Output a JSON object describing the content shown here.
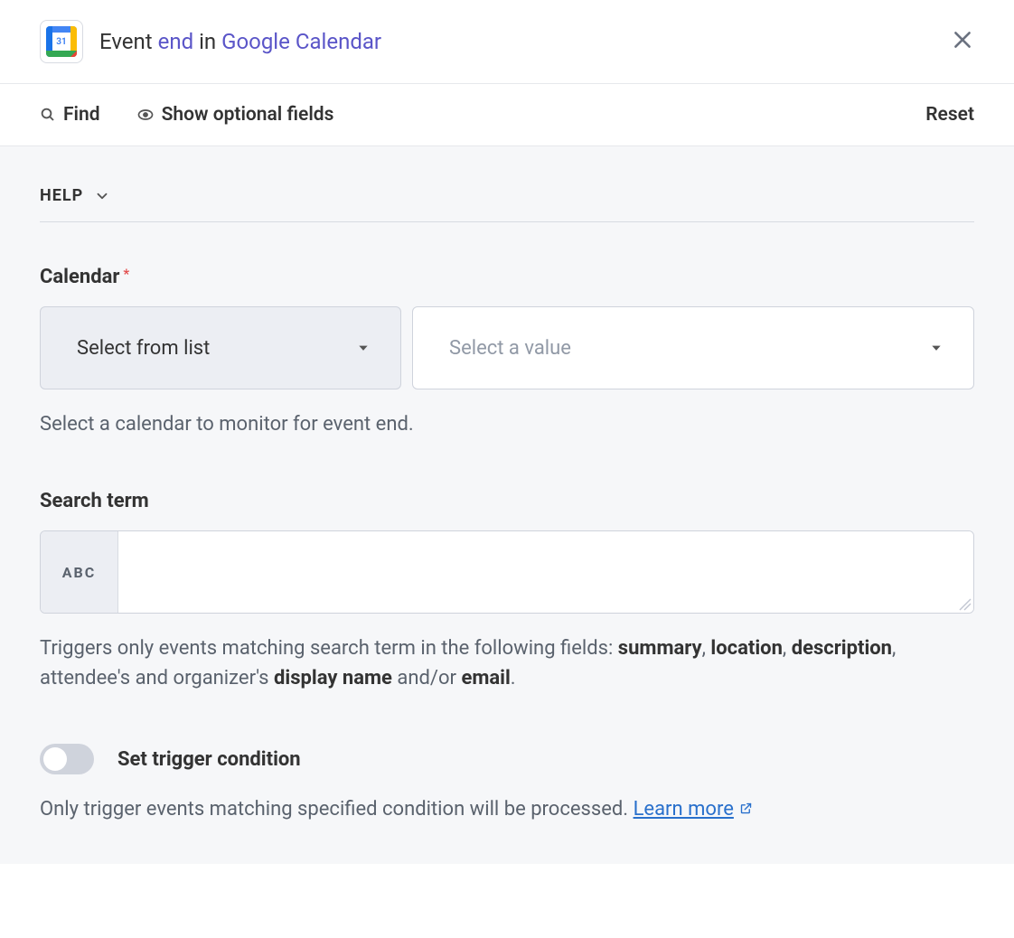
{
  "header": {
    "title_event": "Event",
    "title_end": "end",
    "title_in": "in",
    "title_app": "Google Calendar",
    "icon_day": "31"
  },
  "toolbar": {
    "find_label": "Find",
    "show_optional_label": "Show optional fields",
    "reset_label": "Reset"
  },
  "help": {
    "label": "HELP"
  },
  "fields": {
    "calendar": {
      "label": "Calendar",
      "required": true,
      "mode_label": "Select from list",
      "value_placeholder": "Select a value",
      "hint": "Select a calendar to monitor for event end."
    },
    "search_term": {
      "label": "Search term",
      "prefix": "ABC",
      "value": "",
      "hint_pre": "Triggers only events matching search term in the following fields: ",
      "hint_b1": "summary",
      "hint_s1": ", ",
      "hint_b2": "location",
      "hint_s2": ", ",
      "hint_b3": "description",
      "hint_s3": ", attendee's and organizer's ",
      "hint_b4": "display name",
      "hint_s4": " and/or ",
      "hint_b5": "email",
      "hint_s5": "."
    },
    "trigger_condition": {
      "toggle_label": "Set trigger condition",
      "toggle_on": false,
      "hint_text": "Only trigger events matching specified condition will be processed. ",
      "learn_more": "Learn more"
    }
  }
}
